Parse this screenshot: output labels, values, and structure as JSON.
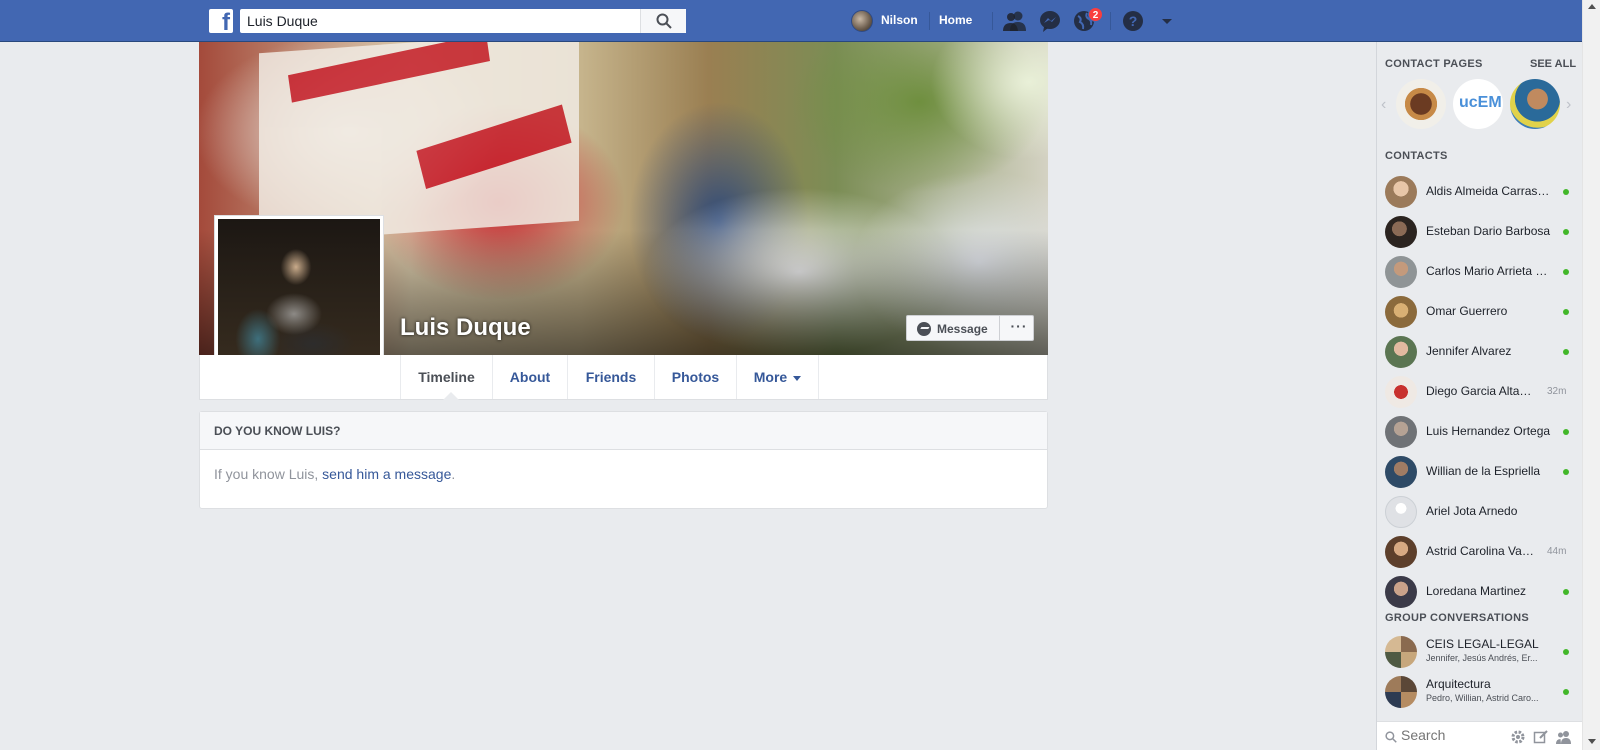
{
  "topbar": {
    "search_value": "Luis Duque",
    "user_name": "Nilson",
    "home_label": "Home",
    "notification_count": "2",
    "brand_color": "#4267b2"
  },
  "profile": {
    "name": "Luis Duque",
    "message_button": "Message",
    "more_actions": "···"
  },
  "tabs": [
    {
      "label": "Timeline",
      "active": true
    },
    {
      "label": "About"
    },
    {
      "label": "Friends"
    },
    {
      "label": "Photos"
    },
    {
      "label": "More"
    }
  ],
  "know_card": {
    "heading": "DO YOU KNOW LUIS?",
    "text_prefix": "If you know Luis, ",
    "link": "send him a message",
    "text_suffix": "."
  },
  "sidebar": {
    "contact_pages_heading": "CONTACT PAGES",
    "see_all": "SEE ALL",
    "contact_pages": [
      {
        "name": "page-1"
      },
      {
        "name": "page-ucem",
        "text": "ucEM"
      },
      {
        "name": "page-3"
      }
    ],
    "contacts_heading": "CONTACTS",
    "contacts": [
      {
        "name": "Aldis Almeida Carrascal",
        "online": true
      },
      {
        "name": "Esteban Dario Barbosa",
        "online": true
      },
      {
        "name": "Carlos Mario Arrieta Otero",
        "online": true
      },
      {
        "name": "Omar Guerrero",
        "online": true
      },
      {
        "name": "Jennifer Alvarez",
        "online": true
      },
      {
        "name": "Diego Garcia Altamiranda",
        "time": "32m"
      },
      {
        "name": "Luis Hernandez Ortega",
        "online": true
      },
      {
        "name": "Willian de la Espriella",
        "online": true
      },
      {
        "name": "Ariel Jota Arnedo"
      },
      {
        "name": "Astrid Carolina Vanegas",
        "time": "44m"
      },
      {
        "name": "Loredana Martinez",
        "online": true
      }
    ],
    "group_heading": "GROUP CONVERSATIONS",
    "groups": [
      {
        "name": "CEIS LEGAL-LEGAL",
        "members": "Jennifer, Jesús Andrés, Er...",
        "online": true
      },
      {
        "name": "Arquitectura",
        "members": "Pedro, Willian, Astrid Caro...",
        "online": true
      }
    ],
    "search_placeholder": "Search"
  }
}
